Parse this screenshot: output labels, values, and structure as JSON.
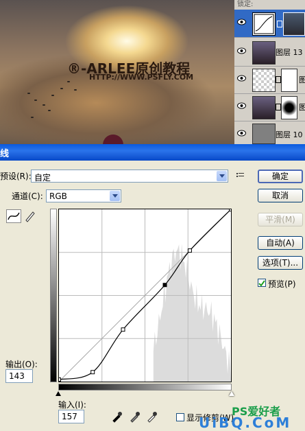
{
  "photo": {
    "watermark": "®-ARLEE原创教程",
    "watermark_url": "HTTP://WWW.PSFLY.COM"
  },
  "layers_panel": {
    "lock_label": "锁定:",
    "layers": [
      {
        "name": "",
        "type": "curves-adjustment"
      },
      {
        "name": "图层 13",
        "type": "image"
      },
      {
        "name": "图",
        "type": "image-with-mask"
      },
      {
        "name": "图",
        "type": "image-with-mask"
      },
      {
        "name": "图层 10",
        "type": "gray"
      }
    ]
  },
  "dialog": {
    "title": "线",
    "preset_label": "预设(R):",
    "preset_value": "自定",
    "channel_label": "通道(C):",
    "channel_value": "RGB",
    "output_label": "输出(O):",
    "output_value": "143",
    "input_label": "输入(I):",
    "input_value": "157",
    "show_clipping_label": "显示修剪(W)",
    "buttons": {
      "ok": "确定",
      "cancel": "取消",
      "smooth": "平滑(M)",
      "auto": "自动(A)",
      "options": "选项(T)...",
      "preview": "预览(P)"
    },
    "preview_checked": true,
    "show_clipping_checked": false
  },
  "site_watermark": "PS爱好者",
  "site_watermark_bottom": "UiBQ.CoM",
  "curve": {
    "points": [
      [
        0,
        3
      ],
      [
        50,
        14
      ],
      [
        95,
        77
      ],
      [
        157,
        143
      ],
      [
        194,
        194
      ],
      [
        255,
        255
      ]
    ]
  }
}
